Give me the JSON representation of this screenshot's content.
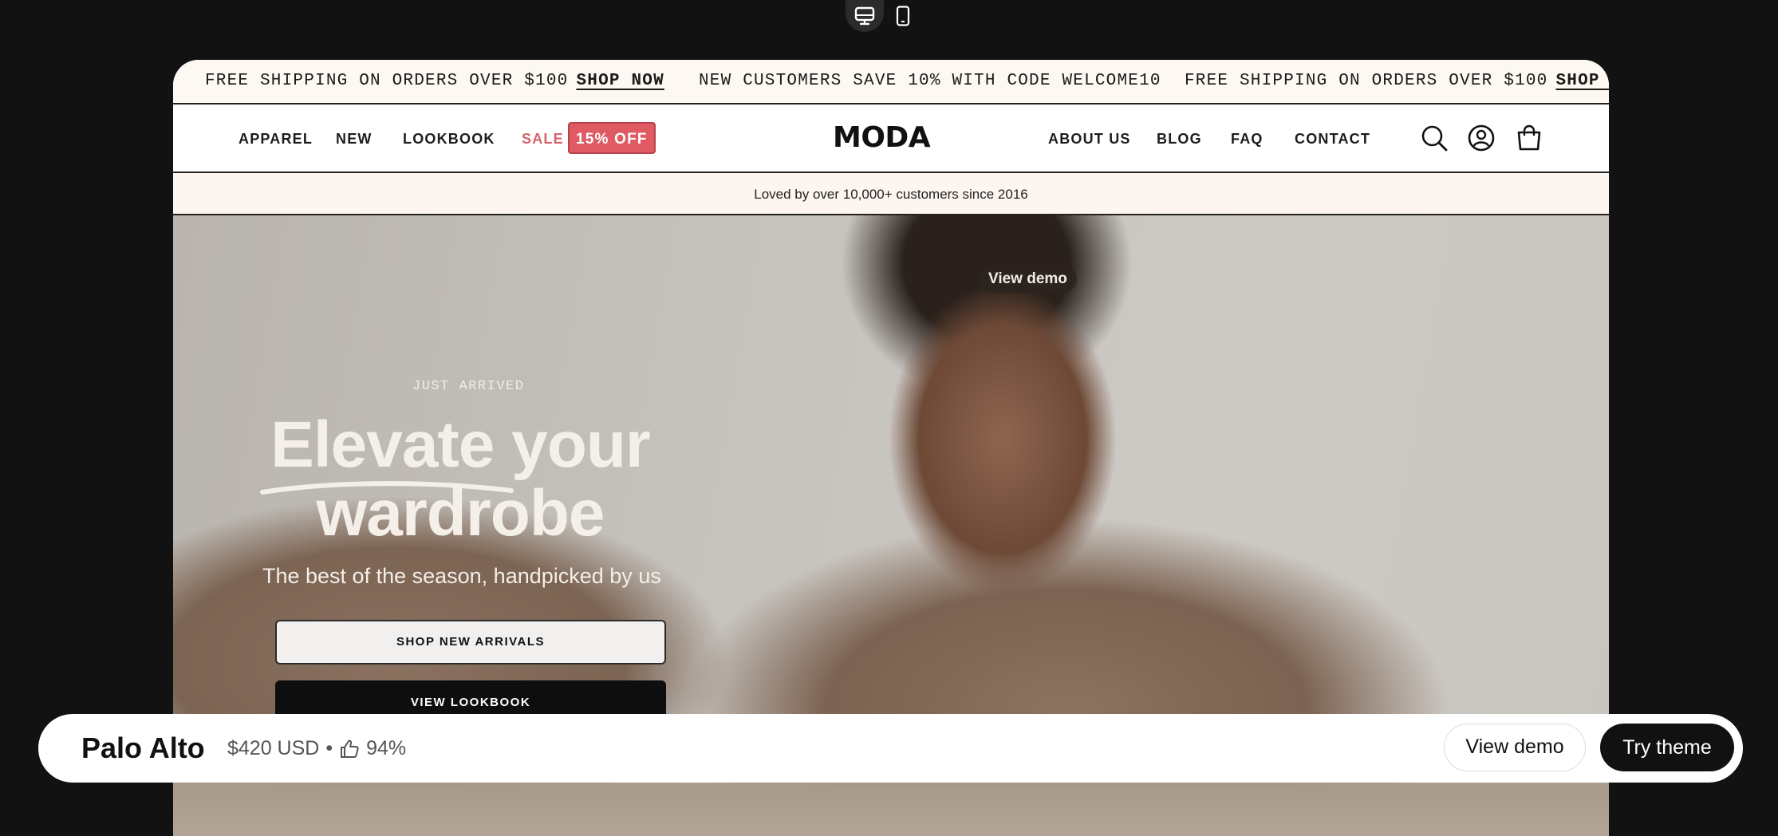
{
  "device_switch": {
    "desktop_icon": "desktop-icon",
    "mobile_icon": "mobile-icon"
  },
  "announcement": {
    "items": [
      {
        "text": "FREE SHIPPING ON ORDERS OVER $100",
        "link": "SHOP NOW"
      },
      {
        "text": "NEW CUSTOMERS SAVE 10% WITH CODE WELCOME10",
        "link": ""
      },
      {
        "text": "FREE SHIPPING ON ORDERS OVER $100",
        "link": "SHOP NOW"
      }
    ]
  },
  "nav": {
    "left": [
      "APPAREL",
      "NEW",
      "LOOKBOOK",
      "SALE"
    ],
    "sale_badge": "15% OFF",
    "logo": "MODA",
    "right": [
      "ABOUT US",
      "BLOG",
      "FAQ",
      "CONTACT"
    ],
    "icons": [
      "search-icon",
      "account-icon",
      "cart-icon"
    ]
  },
  "trust_bar": "Loved by over 10,000+ customers since 2016",
  "hero": {
    "demo_pill": "View demo",
    "kicker": "JUST ARRIVED",
    "headline_1": "Elevate",
    "headline_2": "your",
    "headline_3": "wardrobe",
    "subhead": "The best of the season, handpicked by us",
    "primary_cta": "SHOP NEW ARRIVALS",
    "secondary_cta": "VIEW LOOKBOOK"
  },
  "theme_bar": {
    "name": "Palo Alto",
    "price": "$420 USD",
    "separator": "•",
    "rating": "94%",
    "view_demo": "View demo",
    "try_theme": "Try theme"
  },
  "colors": {
    "sale": "#d8616b",
    "badge": "#df5a63",
    "announce_bg": "#fdf9f2",
    "trust_bg": "#fdf5ef",
    "page_bg": "#121213"
  }
}
